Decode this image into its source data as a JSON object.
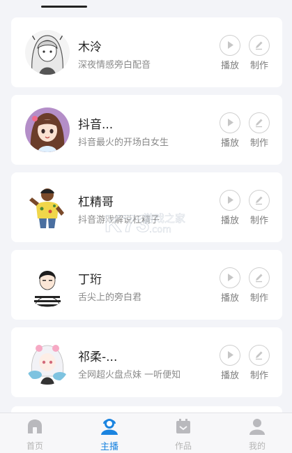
{
  "cards": [
    {
      "name": "木泠",
      "desc": "深夜情感旁白配音",
      "play_label": "播放",
      "make_label": "制作"
    },
    {
      "name": "抖音...",
      "desc": "抖音最火的开场白女生",
      "play_label": "播放",
      "make_label": "制作"
    },
    {
      "name": "杠精哥",
      "desc": "抖音游戏解说杠精子",
      "play_label": "播放",
      "make_label": "制作"
    },
    {
      "name": "丁珩",
      "desc": "舌尖上的旁白君",
      "play_label": "播放",
      "make_label": "制作"
    },
    {
      "name": "祁柔-...",
      "desc": "全网超火盘点妹 一听便知",
      "play_label": "播放",
      "make_label": "制作"
    }
  ],
  "watermark": {
    "big": "K73",
    "line1": "游戏之家",
    "line2": ".com"
  },
  "tabbar": {
    "items": [
      {
        "label": "首页",
        "icon": "home-icon"
      },
      {
        "label": "主播",
        "icon": "anchor-person-icon"
      },
      {
        "label": "作品",
        "icon": "works-icon"
      },
      {
        "label": "我的",
        "icon": "profile-icon"
      }
    ],
    "active_color": "#1b84e0",
    "inactive_color": "#b5b5b5"
  }
}
